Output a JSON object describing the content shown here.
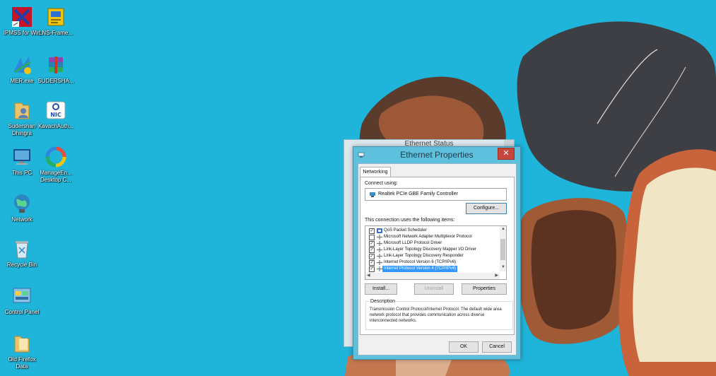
{
  "desktop": {
    "icons": [
      {
        "label": "IPMSS for Win",
        "icon": "ipmss-app-icon",
        "color": "#c8142a"
      },
      {
        "label": "LNS-Frame...",
        "icon": "lns-app-icon",
        "color": "#f1c40f"
      },
      {
        "label": "MER.exe",
        "icon": "mer-app-icon",
        "color": "#2e86de"
      },
      {
        "label": "SUDERSHA...",
        "icon": "winrar-archive-icon",
        "color": "#8e44ad"
      },
      {
        "label": "Sudershan Dhingra",
        "icon": "user-folder-icon",
        "color": "#e9c46a"
      },
      {
        "label": "KavachAuth...",
        "icon": "nic-app-icon",
        "color": "#ffffff"
      },
      {
        "label": "This PC",
        "icon": "this-pc-icon",
        "color": "#5dade2"
      },
      {
        "label": "ManageEn... Desktop C...",
        "icon": "manageengine-icon",
        "color": "#e74c3c"
      },
      {
        "label": "Network",
        "icon": "network-icon",
        "color": "#2e86c1"
      },
      {
        "label": "Recycle Bin",
        "icon": "recycle-bin-icon",
        "color": "#d6eaf8"
      },
      {
        "label": "Control Panel",
        "icon": "control-panel-icon",
        "color": "#85c1e9"
      },
      {
        "label": "Old Firefox Data",
        "icon": "folder-icon",
        "color": "#e9c46a"
      }
    ]
  },
  "background_window": {
    "title": "Ethernet Status"
  },
  "dialog": {
    "title": "Ethernet Properties",
    "close_label": "✕",
    "tab": "Networking",
    "connect_using_label": "Connect using:",
    "adapter_name": "Realtek PCIe GBE Family Controller",
    "configure_label": "Configure...",
    "items_label": "This connection uses the following items:",
    "items": [
      {
        "label": "QoS Packet Scheduler",
        "checked": true,
        "icon": "qos-icon"
      },
      {
        "label": "Microsoft Network Adapter Multiplexor Protocol",
        "checked": false,
        "icon": "protocol-icon"
      },
      {
        "label": "Microsoft LLDP Protocol Driver",
        "checked": true,
        "icon": "protocol-icon"
      },
      {
        "label": "Link-Layer Topology Discovery Mapper I/O Driver",
        "checked": true,
        "icon": "protocol-icon"
      },
      {
        "label": "Link-Layer Topology Discovery Responder",
        "checked": true,
        "icon": "protocol-icon"
      },
      {
        "label": "Internet Protocol Version 6 (TCP/IPv6)",
        "checked": true,
        "icon": "protocol-icon"
      },
      {
        "label": "Internet Protocol Version 4 (TCP/IPv4)",
        "checked": true,
        "icon": "protocol-icon",
        "selected": true
      }
    ],
    "install_label": "Install...",
    "uninstall_label": "Uninstall",
    "properties_label": "Properties",
    "description_title": "Description",
    "description_text": "Transmission Control Protocol/Internet Protocol. The default wide area network protocol that provides communication across diverse interconnected networks.",
    "ok_label": "OK",
    "cancel_label": "Cancel"
  },
  "colors": {
    "desktop_bg": "#1fb4da",
    "title_bar": "#5fc0de",
    "close_button": "#c7463b",
    "selection": "#3399ff"
  }
}
